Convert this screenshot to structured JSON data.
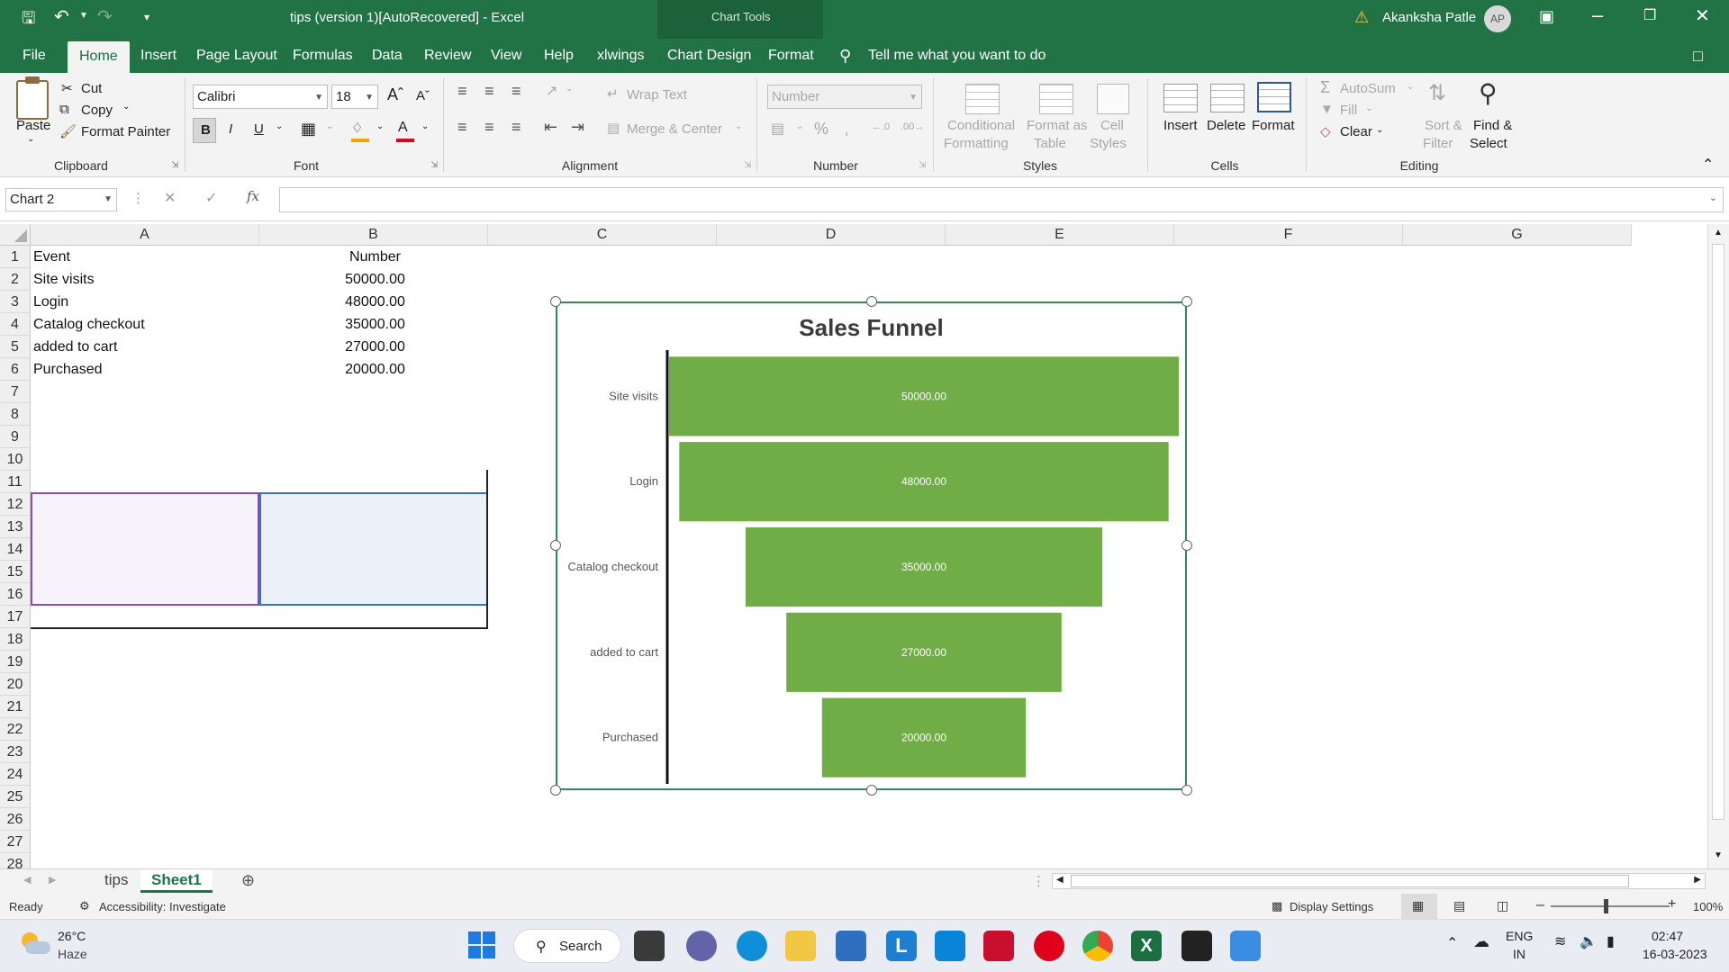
{
  "window": {
    "title": "tips (version 1)[AutoRecovered]  -  Excel",
    "chart_tools": "Chart Tools",
    "user_name": "Akanksha Patle",
    "user_initials": "AP"
  },
  "tabs": [
    "File",
    "Home",
    "Insert",
    "Page Layout",
    "Formulas",
    "Data",
    "Review",
    "View",
    "Help",
    "xlwings",
    "Chart Design",
    "Format"
  ],
  "tell_me": "Tell me what you want to do",
  "ribbon": {
    "clipboard": {
      "paste": "Paste",
      "cut": "Cut",
      "copy": "Copy",
      "format_painter": "Format Painter",
      "label": "Clipboard"
    },
    "font": {
      "name": "Calibri",
      "size": "18",
      "bold": "B",
      "italic": "I",
      "underline": "U",
      "label": "Font"
    },
    "alignment": {
      "wrap_text": "Wrap Text",
      "merge_center": "Merge & Center",
      "label": "Alignment"
    },
    "number": {
      "format": "Number",
      "label": "Number"
    },
    "styles": {
      "conditional_1": "Conditional",
      "conditional_2": "Formatting",
      "format_table_1": "Format as",
      "format_table_2": "Table",
      "cell_styles_1": "Cell",
      "cell_styles_2": "Styles",
      "label": "Styles"
    },
    "cells": {
      "insert": "Insert",
      "delete": "Delete",
      "format": "Format",
      "label": "Cells"
    },
    "editing": {
      "autosum": "AutoSum",
      "fill": "Fill",
      "clear": "Clear",
      "sort_1": "Sort &",
      "sort_2": "Filter",
      "find_1": "Find &",
      "find_2": "Select",
      "label": "Editing"
    }
  },
  "formula_bar": {
    "name_box": "Chart 2",
    "fx": "fx",
    "content": ""
  },
  "columns": [
    "A",
    "B",
    "C",
    "D",
    "E",
    "F",
    "G"
  ],
  "rows": [
    "1",
    "2",
    "3",
    "4",
    "5",
    "6",
    "7",
    "8",
    "9",
    "10",
    "11",
    "12",
    "13",
    "14",
    "15",
    "16",
    "17",
    "18",
    "19",
    "20",
    "21",
    "22",
    "23",
    "24",
    "25",
    "26",
    "27",
    "28"
  ],
  "table": {
    "headers": [
      "Event",
      "Number"
    ],
    "rows": [
      [
        "Site visits",
        "50000.00"
      ],
      [
        "Login",
        "48000.00"
      ],
      [
        "Catalog checkout",
        "35000.00"
      ],
      [
        "added to cart",
        "27000.00"
      ],
      [
        "Purchased",
        "20000.00"
      ]
    ]
  },
  "chart_data": {
    "type": "bar",
    "subtype": "funnel",
    "title": "Sales Funnel",
    "categories": [
      "Site visits",
      "Login",
      "Catalog checkout",
      "added to cart",
      "Purchased"
    ],
    "values": [
      50000,
      48000,
      35000,
      27000,
      20000
    ],
    "data_labels": [
      "50000.00",
      "48000.00",
      "35000.00",
      "27000.00",
      "20000.00"
    ],
    "bar_color": "#70ad47",
    "grid": false,
    "legend": "none"
  },
  "sheets": [
    "tips",
    "Sheet1"
  ],
  "active_sheet": "Sheet1",
  "status": {
    "ready": "Ready",
    "accessibility": "Accessibility: Investigate",
    "display_settings": "Display Settings",
    "zoom": "100%"
  },
  "taskbar": {
    "temperature": "26°C",
    "weather": "Haze",
    "search": "Search",
    "lang_1": "ENG",
    "lang_2": "IN",
    "time": "02:47",
    "date": "16-03-2023"
  },
  "colors": {
    "excel_green": "#217346",
    "accent": "#70ad47"
  }
}
